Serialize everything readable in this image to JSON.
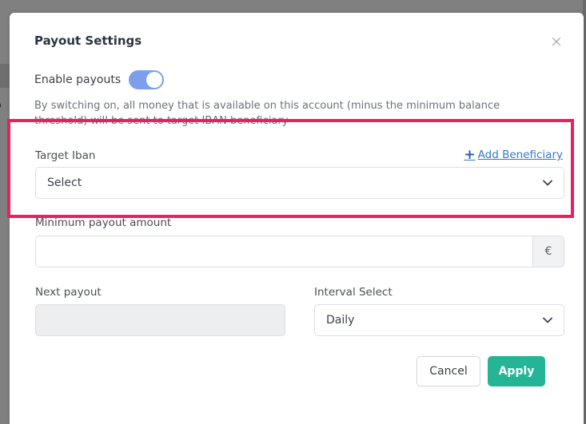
{
  "background": {
    "edge_text": "o"
  },
  "modal": {
    "title": "Payout Settings",
    "close_glyph": "×",
    "enable_payouts": {
      "label": "Enable payouts",
      "checked": true
    },
    "description": "By switching on, all money that is available on this account (minus the minimum balance threshold) will be sent to target IBAN beneficiary",
    "target_iban": {
      "label": "Target Iban",
      "add_link_label": "Add Beneficiary",
      "add_link_glyph": "+",
      "selected_value": "Select"
    },
    "minimum_payout": {
      "label": "Minimum payout amount",
      "value": "",
      "currency_symbol": "€"
    },
    "next_payout": {
      "label": "Next payout",
      "value": ""
    },
    "interval_select": {
      "label": "Interval Select",
      "selected_value": "Daily"
    },
    "buttons": {
      "cancel_label": "Cancel",
      "apply_label": "Apply"
    }
  },
  "colors": {
    "toggle_on": "#7d9ded",
    "apply_button": "#24b596",
    "link": "#3477c9",
    "highlight_border": "#ea1f5d"
  },
  "icons": {
    "close": "close-icon",
    "plus": "plus-icon",
    "chevron": "chevron-down-icon"
  }
}
